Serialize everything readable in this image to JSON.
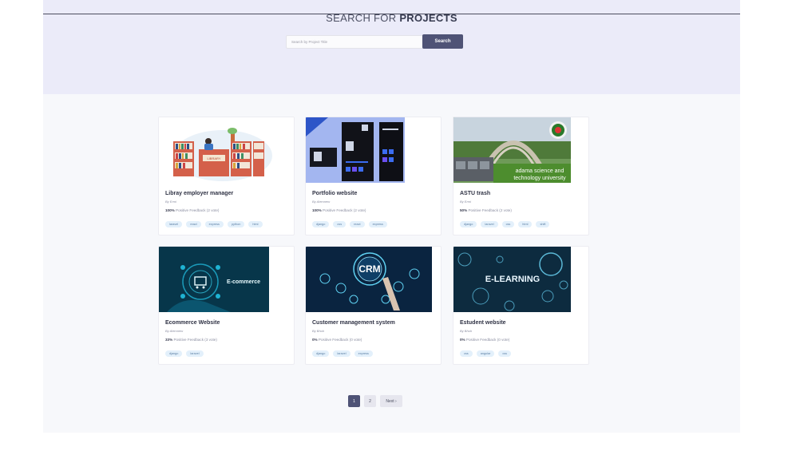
{
  "hero": {
    "title_prefix": "SEARCH FOR",
    "title_bold": "PROJECTS",
    "search_placeholder": "Search by Project Title",
    "search_button": "Search"
  },
  "projects": [
    {
      "title": "Libray employer manager",
      "author": "By Ermi",
      "feedback_pct": "100%",
      "feedback_text": "Positive Feedback (2 vote)",
      "tags": [
        "laravel",
        "react",
        "express",
        "python",
        "html"
      ],
      "image_text": "LIBRARY"
    },
    {
      "title": "Portfolio website",
      "author": "By Alemnew",
      "feedback_pct": "100%",
      "feedback_text": "Positive Feedback (2 vote)",
      "tags": [
        "django",
        "css",
        "react",
        "express"
      ]
    },
    {
      "title": "ASTU trash",
      "author": "By Ermi",
      "feedback_pct": "50%",
      "feedback_text": "Positive Feedback (2 vote)",
      "tags": [
        "django",
        "laravel",
        "css",
        "html",
        "shift"
      ],
      "image_text_1": "adama science and",
      "image_text_2": "technology university"
    },
    {
      "title": "Ecommerce Website",
      "author": "By Alemnew",
      "feedback_pct": "33%",
      "feedback_text": "Positive Feedback (3 vote)",
      "tags": [
        "django",
        "laravel"
      ],
      "image_text": "E-commerce"
    },
    {
      "title": "Customer management system",
      "author": "By Bhuh",
      "feedback_pct": "0%",
      "feedback_text": "Positive Feedback (0 vote)",
      "tags": [
        "django",
        "laravel",
        "express"
      ],
      "image_text": "CRM"
    },
    {
      "title": "Estudent website",
      "author": "By Bhuh",
      "feedback_pct": "0%",
      "feedback_text": "Positive Feedback (0 vote)",
      "tags": [
        "css",
        "angular",
        "css"
      ],
      "image_text": "E-LEARNING"
    }
  ],
  "pagination": {
    "page1": "1",
    "page2": "2",
    "next": "Next ›"
  },
  "colors": {
    "hero_bg": "#ebebf9",
    "button": "#4f5376",
    "tag_bg": "#e3f0fb",
    "tag_text": "#5a7ea3"
  }
}
